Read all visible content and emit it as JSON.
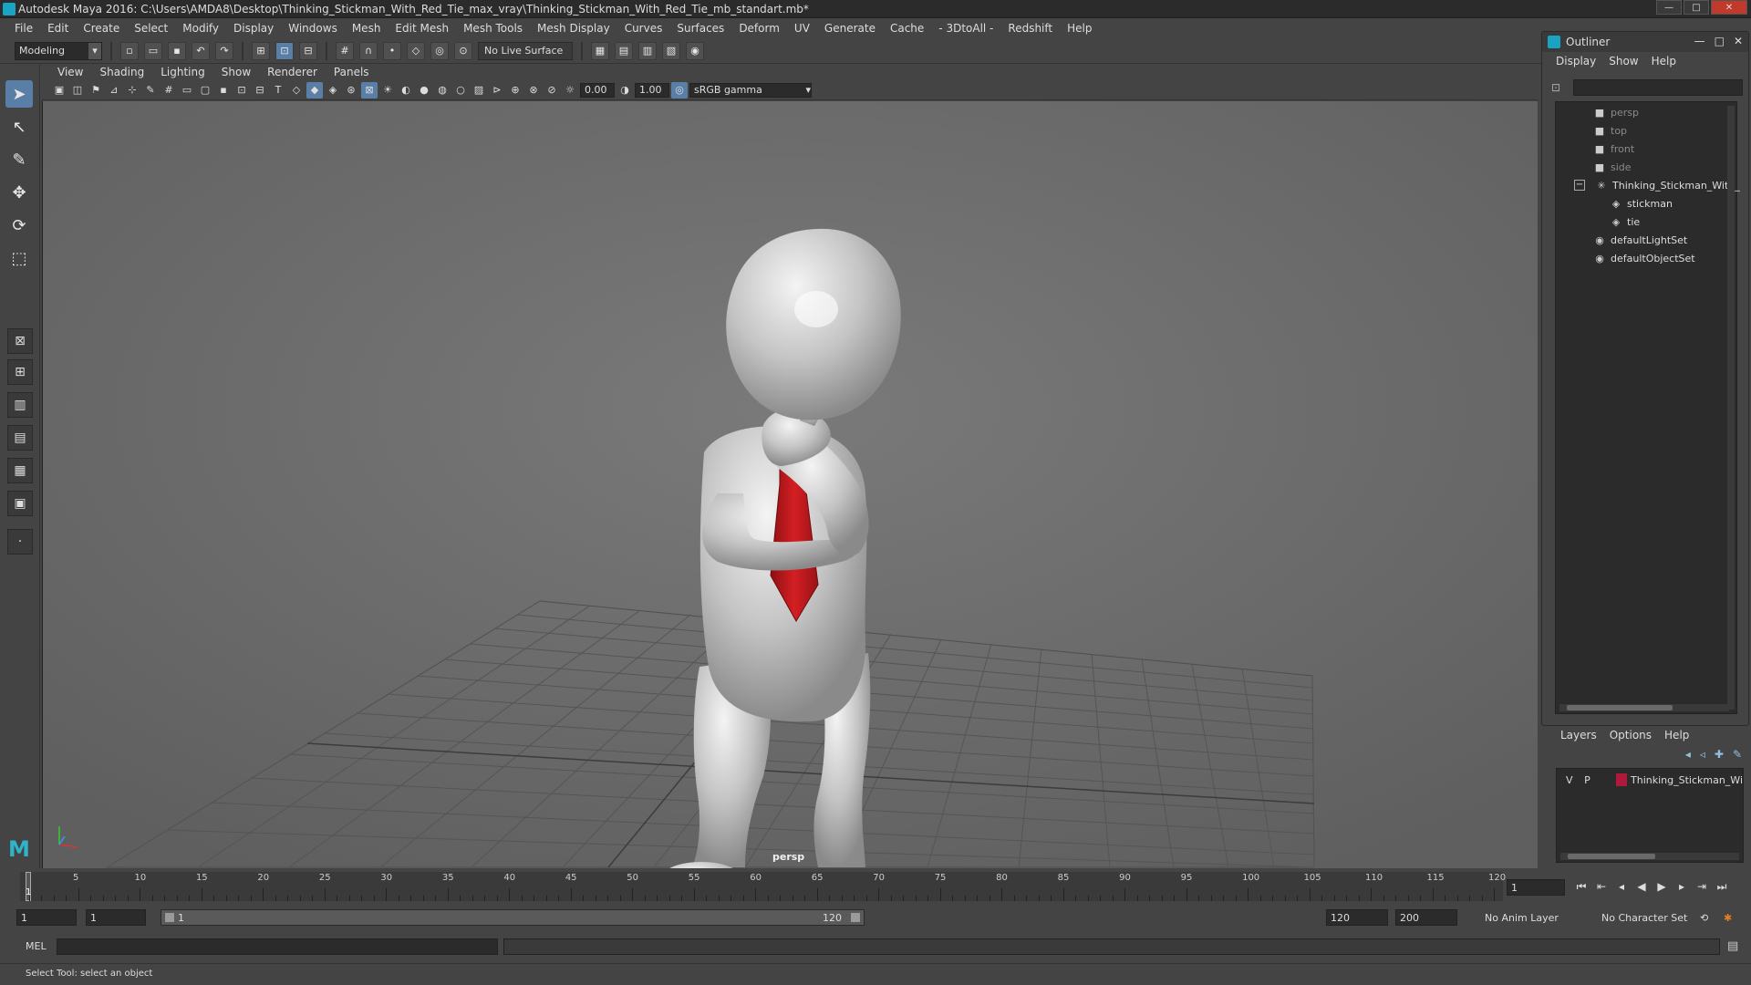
{
  "window": {
    "title": "Autodesk Maya 2016: C:\\Users\\AMDA8\\Desktop\\Thinking_Stickman_With_Red_Tie_max_vray\\Thinking_Stickman_With_Red_Tie_mb_standart.mb*",
    "minimize": "—",
    "maximize": "□",
    "close": "✕"
  },
  "menubar": [
    "File",
    "Edit",
    "Create",
    "Select",
    "Modify",
    "Display",
    "Windows",
    "Mesh",
    "Edit Mesh",
    "Mesh Tools",
    "Mesh Display",
    "Curves",
    "Surfaces",
    "Deform",
    "UV",
    "Generate",
    "Cache",
    "- 3DtoAll -",
    "Redshift",
    "Help"
  ],
  "statusline": {
    "mode": "Modeling",
    "mode_arrow": "▾",
    "live_surface": "No Live Surface"
  },
  "panel": {
    "menu": [
      "View",
      "Shading",
      "Lighting",
      "Show",
      "Renderer",
      "Panels"
    ],
    "exposure": "0.00",
    "gamma": "1.00",
    "color_space": "sRGB gamma",
    "camera_label": "persp"
  },
  "outliner": {
    "title": "Outliner",
    "menu": [
      "Display",
      "Show",
      "Help"
    ],
    "items": [
      {
        "label": "persp",
        "icon": "camera-icon"
      },
      {
        "label": "top",
        "icon": "camera-icon"
      },
      {
        "label": "front",
        "icon": "camera-icon"
      },
      {
        "label": "side",
        "icon": "camera-icon"
      },
      {
        "label": "Thinking_Stickman_With_",
        "icon": "group-icon"
      },
      {
        "label": "stickman",
        "icon": "mesh-icon"
      },
      {
        "label": "tie",
        "icon": "mesh-icon"
      },
      {
        "label": "defaultLightSet",
        "icon": "set-icon"
      },
      {
        "label": "defaultObjectSet",
        "icon": "set-icon"
      }
    ]
  },
  "layers": {
    "menu": [
      "Layers",
      "Options",
      "Help"
    ],
    "row": {
      "v": "V",
      "p": "P",
      "name": "Thinking_Stickman_Wi",
      "color": "#b01a3a"
    }
  },
  "timeline": {
    "ticks": [
      "5",
      "10",
      "15",
      "20",
      "25",
      "30",
      "35",
      "40",
      "45",
      "50",
      "55",
      "60",
      "65",
      "70",
      "75",
      "80",
      "85",
      "90",
      "95",
      "100",
      "105",
      "110",
      "115",
      "120"
    ],
    "current_frame_marker": "1",
    "current_frame": "1"
  },
  "range": {
    "start": "1",
    "playback_start": "1",
    "slider_start": "1",
    "slider_end": "120",
    "playback_end": "120",
    "end": "200",
    "anim_layer": "No Anim Layer",
    "character_set": "No Character Set"
  },
  "cmdline": {
    "label": "MEL"
  },
  "helpline": {
    "text": "Select Tool: select an object"
  },
  "colors": {
    "viewport_bg": "#6e6e6e",
    "tie_red": "#c0191e",
    "accent": "#5a7fa7"
  }
}
